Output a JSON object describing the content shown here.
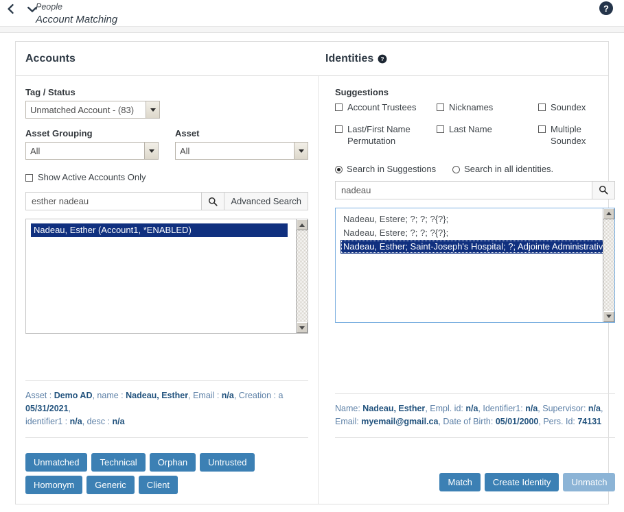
{
  "header": {
    "breadcrumb_parent": "People",
    "title": "Account Matching",
    "back_icon": "chevron-left-icon",
    "down_icon": "chevron-down-icon",
    "help_icon": "help-circle-icon"
  },
  "accounts": {
    "panel_title": "Accounts",
    "tag_status_label": "Tag / Status",
    "tag_status_value": "Unmatched Account - (83)",
    "asset_grouping_label": "Asset Grouping",
    "asset_grouping_value": "All",
    "asset_label": "Asset",
    "asset_value": "All",
    "show_active_label": "Show Active Accounts Only",
    "show_active_checked": false,
    "search_value": "esther nadeau",
    "search_placeholder": "",
    "search_icon": "search-icon",
    "advanced_search_label": "Advanced Search",
    "list_items": [
      {
        "text": "Nadeau, Esther (Account1, *ENABLED)",
        "selected": true
      }
    ],
    "details": [
      [
        {
          "t": "Asset : ",
          "b": false
        },
        {
          "t": "Demo AD",
          "b": true
        },
        {
          "t": ", name : ",
          "b": false
        },
        {
          "t": "Nadeau, Esther",
          "b": true
        },
        {
          "t": ", Email : ",
          "b": false
        },
        {
          "t": "n/a",
          "b": true
        },
        {
          "t": ", Creation : a ",
          "b": false
        },
        {
          "t": "05/31/2021",
          "b": true
        },
        {
          "t": ",",
          "b": false
        }
      ],
      [
        {
          "t": "identifier1 : ",
          "b": false
        },
        {
          "t": "n/a",
          "b": true
        },
        {
          "t": ", desc : ",
          "b": false
        },
        {
          "t": "n/a",
          "b": true
        }
      ]
    ],
    "buttons": [
      {
        "label": "Unmatched",
        "disabled": false
      },
      {
        "label": "Technical",
        "disabled": false
      },
      {
        "label": "Orphan",
        "disabled": false
      },
      {
        "label": "Untrusted",
        "disabled": false
      },
      {
        "label": "Homonym",
        "disabled": false
      },
      {
        "label": "Generic",
        "disabled": false
      },
      {
        "label": "Client",
        "disabled": false
      }
    ]
  },
  "identities": {
    "panel_title": "Identities",
    "help_icon": "help-circle-icon",
    "suggestions_label": "Suggestions",
    "suggestions": [
      {
        "label": "Account Trustees",
        "checked": false
      },
      {
        "label": "Nicknames",
        "checked": false
      },
      {
        "label": "Soundex",
        "checked": false
      },
      {
        "label": "Last/First Name Permutation",
        "checked": false
      },
      {
        "label": "Last Name",
        "checked": false
      },
      {
        "label": "Multiple Soundex",
        "checked": false
      }
    ],
    "scope_options": [
      {
        "label": "Search in Suggestions",
        "selected": true
      },
      {
        "label": "Search in all identities.",
        "selected": false
      }
    ],
    "search_value": "nadeau",
    "search_placeholder": "",
    "search_icon": "search-icon",
    "list_items": [
      {
        "text": "Nadeau, Estere; ?; ?; ?{?};",
        "selected": false
      },
      {
        "text": "Nadeau, Estere; ?; ?; ?{?};",
        "selected": false
      },
      {
        "text": "Nadeau, Esther; Saint-Joseph's Hospital; ?; Adjointe Administrative",
        "selected": true
      }
    ],
    "details": [
      [
        {
          "t": "Name: ",
          "b": false
        },
        {
          "t": "Nadeau, Esther",
          "b": true
        },
        {
          "t": ", Empl. id: ",
          "b": false
        },
        {
          "t": "n/a",
          "b": true
        },
        {
          "t": ", Identifier1: ",
          "b": false
        },
        {
          "t": "n/a",
          "b": true
        },
        {
          "t": ", Supervisor: ",
          "b": false
        },
        {
          "t": "n/a",
          "b": true
        },
        {
          "t": ",",
          "b": false
        }
      ],
      [
        {
          "t": "Email: ",
          "b": false
        },
        {
          "t": "myemail@gmail.ca",
          "b": true
        },
        {
          "t": ", Date of Birth: ",
          "b": false
        },
        {
          "t": "05/01/2000",
          "b": true
        },
        {
          "t": ", Pers. Id: ",
          "b": false
        },
        {
          "t": "74131",
          "b": true
        }
      ]
    ],
    "buttons": [
      {
        "label": "Match",
        "disabled": false
      },
      {
        "label": "Create Identity",
        "disabled": false
      },
      {
        "label": "Unmatch",
        "disabled": true
      }
    ]
  },
  "colors": {
    "button_blue": "#3c80b4",
    "button_blue_disabled": "#8cb4d6",
    "selection_navy": "#10307f",
    "detail_label": "#5b7fa6",
    "detail_value": "#21527d"
  }
}
